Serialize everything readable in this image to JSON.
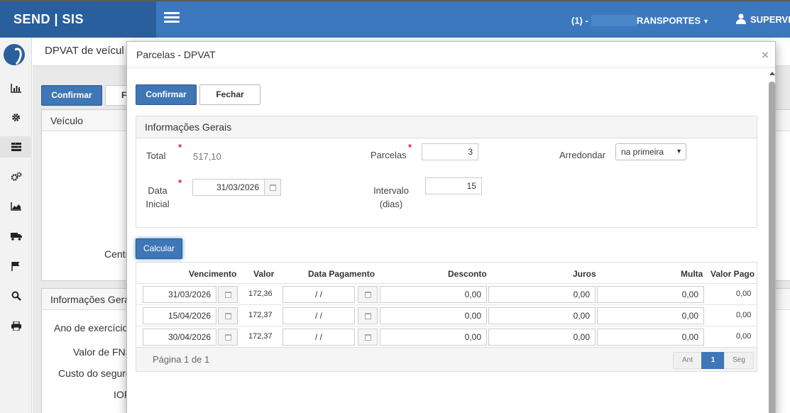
{
  "app": {
    "brand": "SEND | SIS",
    "company_prefix": "(1) -",
    "company_suffix": "RANSPORTES",
    "user": "SUPERVI"
  },
  "sidebar": {
    "items": [
      "chart-icon",
      "gear-icon",
      "list-icon",
      "gears-icon",
      "area-chart-icon",
      "truck-icon",
      "flag-icon",
      "search-icon",
      "print-icon"
    ]
  },
  "background": {
    "page_title": "DPVAT de veícul",
    "confirm_label": "Confirmar",
    "second_button_label": "F",
    "panel_vehicle_title": "Veículo",
    "center_label": "Centr",
    "panel_info_title": "Informações Gera",
    "labels": [
      "Ano de exercício",
      "Valor de FNS",
      "Custo do seguro",
      "IOF"
    ]
  },
  "modal": {
    "title": "Parcelas - DPVAT",
    "close_symbol": "×",
    "confirm_label": "Confirmar",
    "close_label": "Fechar",
    "info_title": "Informações Gerais",
    "required_mark": "*",
    "total_label": "Total",
    "total_value": "517,10",
    "parcelas_label": "Parcelas",
    "parcelas_value": "3",
    "arredondar_label": "Arredondar",
    "arredondar_value": "na primeira",
    "data_inicial_label_1": "Data",
    "data_inicial_label_2": "Inicial",
    "data_inicial_value": "31/03/2026",
    "intervalo_label_1": "Intervalo",
    "intervalo_label_2": "(dias)",
    "intervalo_value": "15",
    "calcular_label": "Calcular"
  },
  "grid": {
    "headers": {
      "vencimento": "Vencimento",
      "valor": "Valor",
      "data_pagamento": "Data Pagamento",
      "desconto": "Desconto",
      "juros": "Juros",
      "multa": "Multa",
      "valor_pago": "Valor Pago"
    },
    "rows": [
      {
        "vencimento": "31/03/2026",
        "valor": "172,36",
        "data_pagamento": "/ /",
        "desconto": "0,00",
        "juros": "0,00",
        "multa": "0,00",
        "valor_pago": "0,00"
      },
      {
        "vencimento": "15/04/2026",
        "valor": "172,37",
        "data_pagamento": "/ /",
        "desconto": "0,00",
        "juros": "0,00",
        "multa": "0,00",
        "valor_pago": "0,00"
      },
      {
        "vencimento": "30/04/2026",
        "valor": "172,37",
        "data_pagamento": "/ /",
        "desconto": "0,00",
        "juros": "0,00",
        "multa": "0,00",
        "valor_pago": "0,00"
      }
    ],
    "page_info": "Página 1 de 1",
    "pager": {
      "prev": "Ant",
      "current": "1",
      "next": "Seg"
    }
  },
  "colors": {
    "topbar": "#3c78bd",
    "brand_bg": "#2a5f9e",
    "primary_button": "#3f76b5",
    "required": "#d9222a"
  }
}
